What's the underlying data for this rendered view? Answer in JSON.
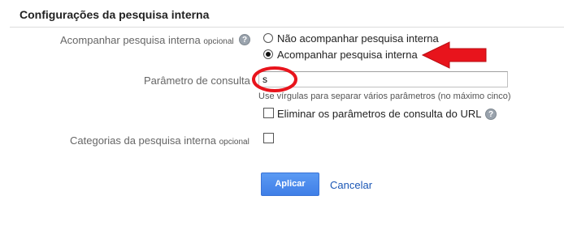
{
  "section": {
    "title": "Configurações da pesquisa interna"
  },
  "tracking": {
    "label": "Acompanhar pesquisa interna",
    "optional": "opcional",
    "help": "?",
    "options": [
      {
        "label": "Não acompanhar pesquisa interna",
        "selected": false
      },
      {
        "label": "Acompanhar pesquisa interna",
        "selected": true
      }
    ]
  },
  "query_param": {
    "label": "Parâmetro de consulta",
    "value": "s",
    "hint": "Use vírgulas para separar vários parâmetros (no máximo cinco)",
    "strip": {
      "label": "Eliminar os parâmetros de consulta do URL",
      "checked": false,
      "help": "?"
    }
  },
  "categories": {
    "label": "Categorias da pesquisa interna",
    "optional": "opcional",
    "checked": false
  },
  "actions": {
    "apply": "Aplicar",
    "cancel": "Cancelar"
  },
  "colors": {
    "annotation": "#e8141c",
    "primary_button": "#4d8ef0",
    "link": "#1a56b5"
  }
}
